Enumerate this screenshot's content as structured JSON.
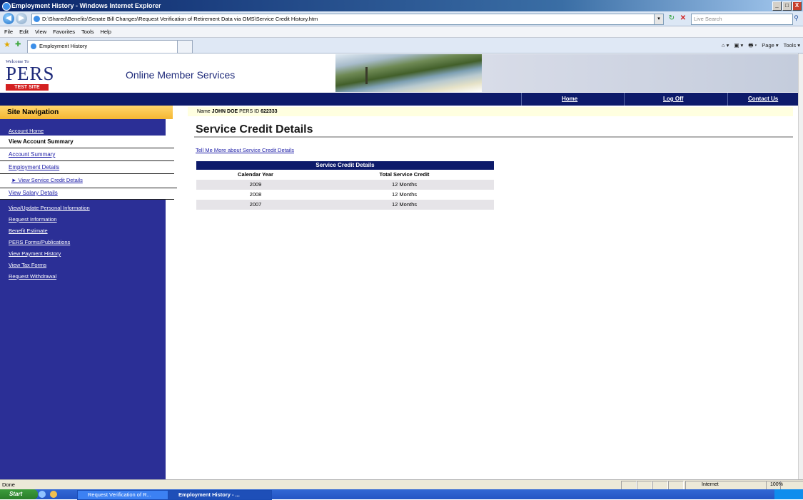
{
  "window": {
    "title": "Employment History - Windows Internet Explorer",
    "min_label": "_",
    "max_label": "□",
    "close_label": "X"
  },
  "address": {
    "back": "◀",
    "forward": "▶",
    "url": "D:\\Shared\\Benefits\\Senate Bill Changes\\Request Verification of Retirement Data via OMS\\Service Credit History.htm",
    "dropdown": "▾",
    "refresh": "↻",
    "stop": "✕",
    "search_placeholder": "Live Search",
    "search_btn": "⚲"
  },
  "menubar": [
    "File",
    "Edit",
    "View",
    "Favorites",
    "Tools",
    "Help"
  ],
  "tabs": {
    "fav_star": "★",
    "add_fav": "✚",
    "active_tab": "Employment History",
    "commands": [
      "⌂ ▾",
      "▣ ▾",
      "🖶 ▾",
      "Page ▾",
      "Tools ▾"
    ]
  },
  "header": {
    "welcome": "Welcome To",
    "logo_text": "PERS",
    "test_site": "TEST SITE",
    "service_name": "Online Member Services"
  },
  "topnav": {
    "home": "Home",
    "logoff": "Log Off",
    "contact": "Contact Us"
  },
  "sidebar": {
    "heading": "Site Navigation",
    "account_home": "Account Home",
    "view_account_summary": "View Account Summary",
    "account_summary": "Account Summary",
    "employment_details": "Employment Details",
    "service_credit_details": "► View Service Credit Details",
    "salary_details": "View Salary Details",
    "links": [
      "View/Update Personal Information",
      "Request Information",
      "Benefit Estimate",
      "PERS Forms/Publications",
      "View Payment History",
      "View Tax Forms",
      "Request Withdrawal"
    ]
  },
  "member": {
    "name_label": "Name",
    "name": "JOHN DOE",
    "id_label": "PERS ID",
    "id": "622333"
  },
  "main": {
    "title": "Service Credit Details",
    "tell_more": "Tell Me More about Service Credit Details",
    "table": {
      "caption": "Service Credit Details",
      "col1": "Calendar Year",
      "col2": "Total Service Credit",
      "rows": [
        {
          "year": "2009",
          "credit": "12 Months"
        },
        {
          "year": "2008",
          "credit": "12 Months"
        },
        {
          "year": "2007",
          "credit": "12 Months"
        }
      ]
    }
  },
  "status": {
    "text": "Done",
    "zone": "Internet",
    "zoom": "100%"
  },
  "taskbar": {
    "start": "Start",
    "task1": "Request Verification of R...",
    "task2": "Employment History - ..."
  },
  "colors": {
    "nav_blue": "#0d1a6a",
    "sidebar_purple": "#2b2f96",
    "heading_gold": "#f5b732",
    "test_site_red": "#d42020"
  }
}
